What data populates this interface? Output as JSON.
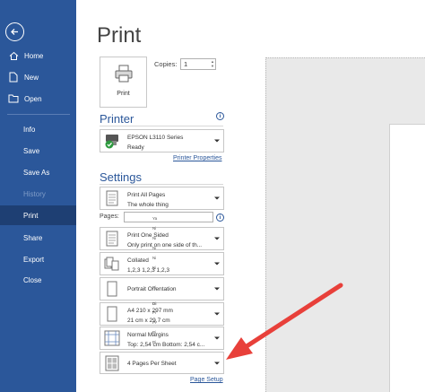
{
  "sidebar": {
    "back_icon": "back-arrow-icon",
    "items": [
      {
        "label": "Home",
        "icon": "home-icon"
      },
      {
        "label": "New",
        "icon": "new-doc-icon"
      },
      {
        "label": "Open",
        "icon": "folder-icon"
      },
      {
        "label": "Info"
      },
      {
        "label": "Save"
      },
      {
        "label": "Save As"
      },
      {
        "label": "History"
      },
      {
        "label": "Print"
      },
      {
        "label": "Share"
      },
      {
        "label": "Export"
      },
      {
        "label": "Close"
      }
    ]
  },
  "main": {
    "title": "Print",
    "print_button_label": "Print",
    "copies_label": "Copies:",
    "copies_value": "1"
  },
  "printer": {
    "heading": "Printer",
    "name": "EPSON L3110 Series",
    "status": "Ready",
    "properties_link": "Printer Properties"
  },
  "settings": {
    "heading": "Settings",
    "pages_label": "Pages:",
    "pages_value": "",
    "options": [
      {
        "line1": "Print All Pages",
        "line2": "The whole thing"
      },
      {
        "line1": "Print One Sided",
        "line2": "Only print on one side of th..."
      },
      {
        "line1": "Collated",
        "line2": "1,2,3    1,2,3    1,2,3"
      },
      {
        "line1": "Portrait Orientation",
        "line2": ""
      },
      {
        "line1": "A4 210 x 297 mm",
        "line2": "21 cm x 29,7 cm"
      },
      {
        "line1": "Normal Margins",
        "line2": "Top: 2,54 cm Bottom: 2,54 c..."
      },
      {
        "line1": "4 Pages Per Sheet",
        "line2": ""
      }
    ],
    "page_setup_link": "Page Setup"
  },
  "preview": {
    "lines": [
      "Ya",
      "Ni",
      "Ni",
      "Ni",
      "Ni",
      "Ni",
      "Pi",
      "Di",
      "Pi",
      "Pi",
      "Pi",
      "Pi"
    ]
  },
  "colors": {
    "sidebar": "#2b579a",
    "sidebar_active": "#1e3f73",
    "accent": "#2b579a",
    "arrow": "#e8403a"
  }
}
